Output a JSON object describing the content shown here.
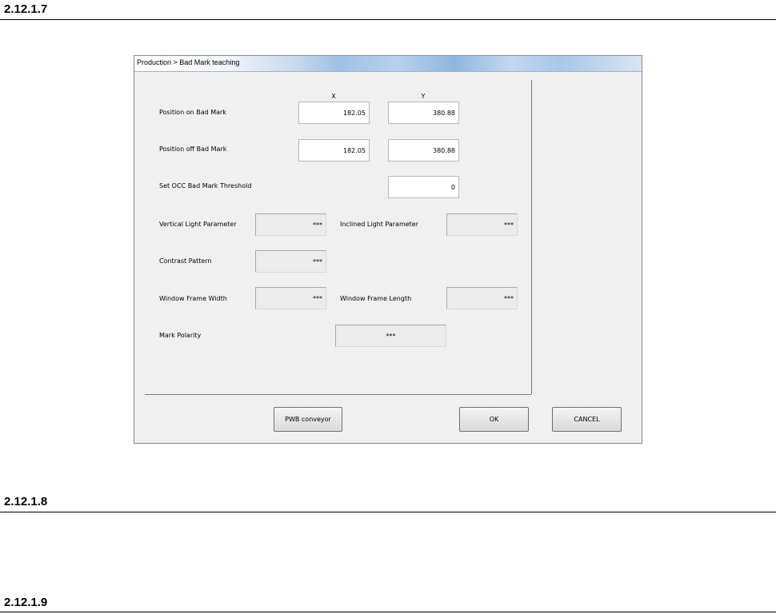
{
  "document": {
    "sections": [
      {
        "heading": "2.12.1.7"
      },
      {
        "heading": "2.12.1.8"
      },
      {
        "heading": "2.12.1.9"
      }
    ]
  },
  "dialog": {
    "title": "Production > Bad Mark teaching",
    "column_headers": {
      "x": "X",
      "y": "Y"
    },
    "rows": {
      "position_on": {
        "label": "Position on Bad Mark",
        "x_value": "182.05",
        "y_value": "380.88"
      },
      "position_off": {
        "label": "Position off Bad Mark",
        "x_value": "182.05",
        "y_value": "380.88"
      },
      "threshold": {
        "label": "Set OCC Bad Mark Threshold",
        "value": "0"
      },
      "vertical_light": {
        "label": "Vertical Light Parameter",
        "value": "***"
      },
      "inclined_light": {
        "label": "Inclined Light Parameter",
        "value": "***"
      },
      "contrast_pattern": {
        "label": "Contrast Pattern",
        "value": "***"
      },
      "window_width": {
        "label": "Window Frame Width",
        "value": "***"
      },
      "window_length": {
        "label": "Window Frame Length",
        "value": "***"
      },
      "mark_polarity": {
        "label": "Mark Polarity",
        "value": "***"
      }
    },
    "buttons": {
      "pwb_conveyor": "PWB conveyor",
      "ok": "OK",
      "cancel": "CANCEL"
    }
  }
}
